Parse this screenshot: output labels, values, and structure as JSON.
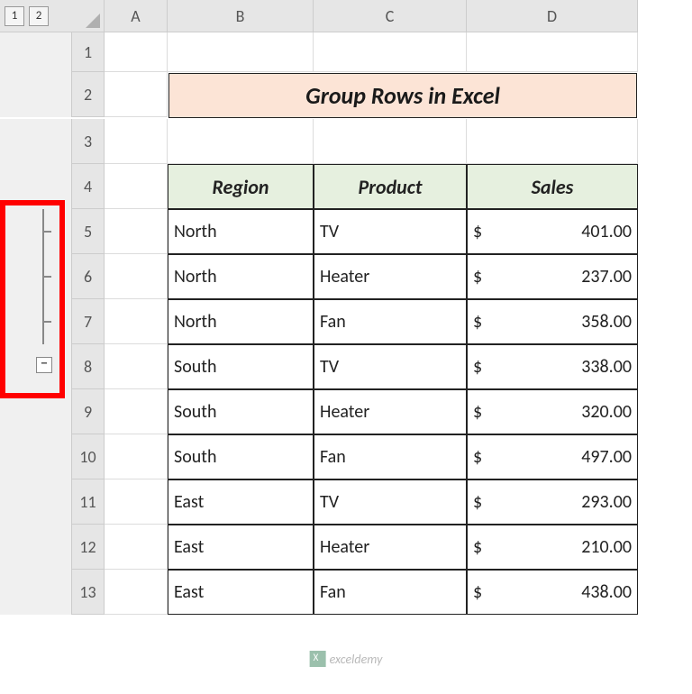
{
  "outline_levels": [
    "1",
    "2"
  ],
  "columns": [
    "A",
    "B",
    "C",
    "D"
  ],
  "rows": [
    "1",
    "2",
    "3",
    "4",
    "5",
    "6",
    "7",
    "8",
    "9",
    "10",
    "11",
    "12",
    "13"
  ],
  "title": "Group Rows in Excel",
  "headers": {
    "region": "Region",
    "product": "Product",
    "sales": "Sales"
  },
  "records": [
    {
      "region": "North",
      "product": "TV",
      "sales": "401.00"
    },
    {
      "region": "North",
      "product": "Heater",
      "sales": "237.00"
    },
    {
      "region": "North",
      "product": "Fan",
      "sales": "358.00"
    },
    {
      "region": "South",
      "product": "TV",
      "sales": "338.00"
    },
    {
      "region": "South",
      "product": "Heater",
      "sales": "320.00"
    },
    {
      "region": "South",
      "product": "Fan",
      "sales": "497.00"
    },
    {
      "region": "East",
      "product": "TV",
      "sales": "293.00"
    },
    {
      "region": "East",
      "product": "Heater",
      "sales": "210.00"
    },
    {
      "region": "East",
      "product": "Fan",
      "sales": "438.00"
    }
  ],
  "currency": "$",
  "outline_button": "−",
  "watermark": "exceldemy",
  "chart_data": {
    "type": "table",
    "title": "Group Rows in Excel",
    "columns": [
      "Region",
      "Product",
      "Sales"
    ],
    "rows": [
      [
        "North",
        "TV",
        401.0
      ],
      [
        "North",
        "Heater",
        237.0
      ],
      [
        "North",
        "Fan",
        358.0
      ],
      [
        "South",
        "TV",
        338.0
      ],
      [
        "South",
        "Heater",
        320.0
      ],
      [
        "South",
        "Fan",
        497.0
      ],
      [
        "East",
        "TV",
        293.0
      ],
      [
        "East",
        "Heater",
        210.0
      ],
      [
        "East",
        "Fan",
        438.0
      ]
    ]
  }
}
